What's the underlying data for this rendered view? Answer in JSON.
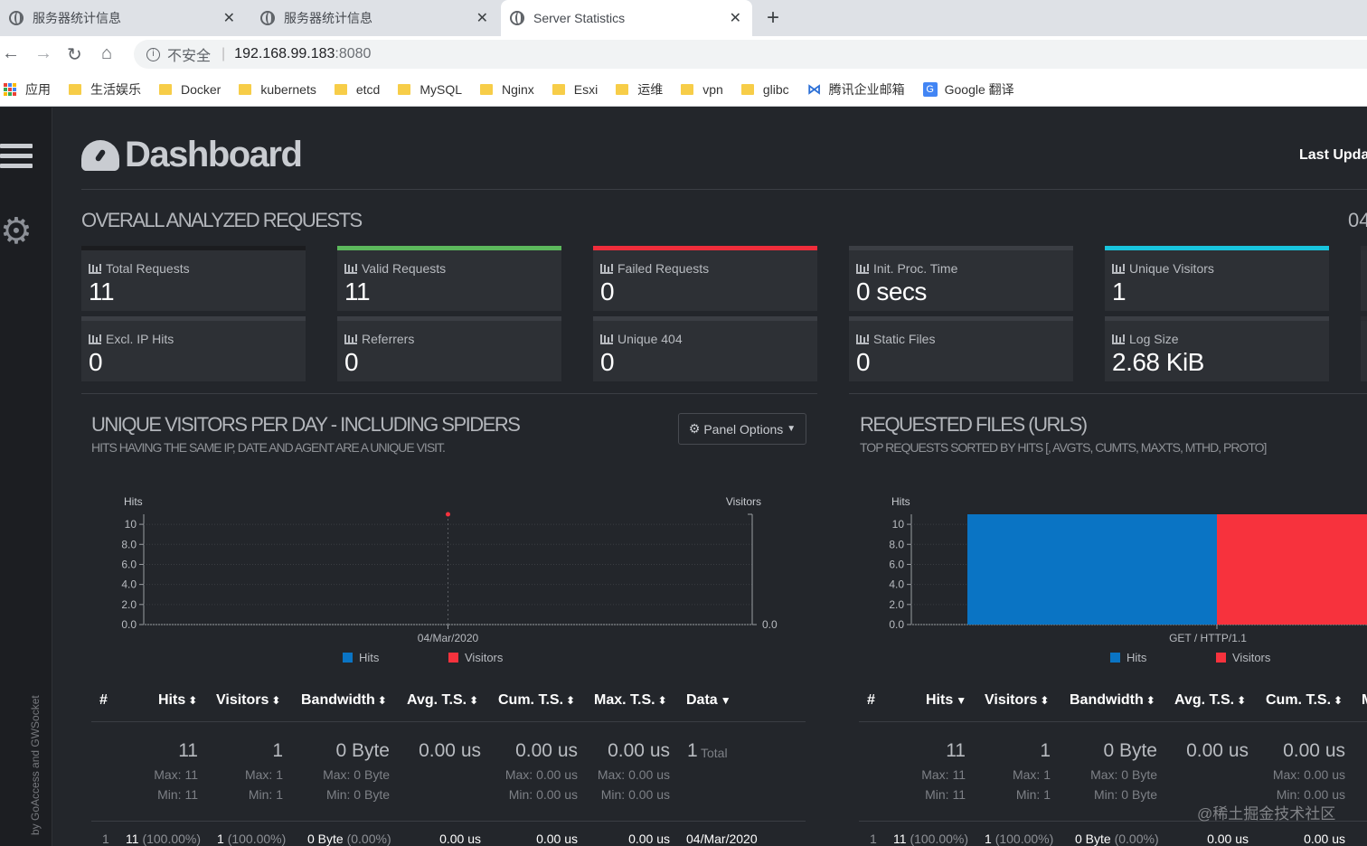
{
  "browser": {
    "tabs": [
      {
        "title": "服务器统计信息",
        "active": false
      },
      {
        "title": "服务器统计信息",
        "active": false
      },
      {
        "title": "Server Statistics",
        "active": true
      }
    ],
    "new_tab_icon": "plus-icon",
    "insecure_label": "不安全",
    "url_host": "192.168.99.183",
    "url_port": ":8080",
    "bookmarks": [
      {
        "label": "应用",
        "icon": "apps-grid-icon"
      },
      {
        "label": "生活娱乐",
        "icon": "folder-icon"
      },
      {
        "label": "Docker",
        "icon": "folder-icon"
      },
      {
        "label": "kubernets",
        "icon": "folder-icon"
      },
      {
        "label": "etcd",
        "icon": "folder-icon"
      },
      {
        "label": "MySQL",
        "icon": "folder-icon"
      },
      {
        "label": "Nginx",
        "icon": "folder-icon"
      },
      {
        "label": "Esxi",
        "icon": "folder-icon"
      },
      {
        "label": "运维",
        "icon": "folder-icon"
      },
      {
        "label": "vpn",
        "icon": "folder-icon"
      },
      {
        "label": "glibc",
        "icon": "folder-icon"
      },
      {
        "label": "腾讯企业邮箱",
        "icon": "tencent-mail-icon"
      },
      {
        "label": "Google 翻译",
        "icon": "google-translate-icon"
      }
    ]
  },
  "dashboard": {
    "title": "Dashboard",
    "last_updated": "Last Upda",
    "byline": "by GoAccess and GWSocket",
    "section_title": "OVERALL ANALYZED REQUESTS",
    "section_date": "04",
    "cards_row1": [
      {
        "label": "Total Requests",
        "value": "11",
        "accent": "#1b1c1f"
      },
      {
        "label": "Valid Requests",
        "value": "11",
        "accent": "#5cb85c"
      },
      {
        "label": "Failed Requests",
        "value": "0",
        "accent": "#ef2d3b"
      },
      {
        "label": "Init. Proc. Time",
        "value": "0 secs",
        "accent": "#3b3e44"
      },
      {
        "label": "Unique Visitors",
        "value": "1",
        "accent": "#18c4dd"
      }
    ],
    "cards_row2": [
      {
        "label": "Excl. IP Hits",
        "value": "0"
      },
      {
        "label": "Referrers",
        "value": "0"
      },
      {
        "label": "Unique 404",
        "value": "0"
      },
      {
        "label": "Static Files",
        "value": "0"
      },
      {
        "label": "Log Size",
        "value": "2.68 KiB"
      }
    ]
  },
  "visitors_panel": {
    "title": "UNIQUE VISITORS PER DAY - INCLUDING SPIDERS",
    "subtitle": "HITS HAVING THE SAME IP, DATE AND AGENT ARE A UNIQUE VISIT.",
    "options_label": "Panel Options",
    "legend": [
      "Hits",
      "Visitors"
    ],
    "columns": [
      "#",
      "Hits",
      "Visitors",
      "Bandwidth",
      "Avg. T.S.",
      "Cum. T.S.",
      "Max. T.S.",
      "Data"
    ],
    "summary": {
      "hits": "11",
      "hits_max": "Max: 11",
      "hits_min": "Min: 11",
      "visitors": "1",
      "visitors_max": "Max: 1",
      "visitors_min": "Min: 1",
      "bandwidth": "0 Byte",
      "bandwidth_max": "Max: 0 Byte",
      "bandwidth_min": "Min: 0 Byte",
      "avg_ts": "0.00 us",
      "cum_ts": "0.00 us",
      "cum_ts_max": "Max: 0.00 us",
      "cum_ts_min": "Min: 0.00 us",
      "max_ts": "0.00 us",
      "max_ts_max": "Max: 0.00 us",
      "max_ts_min": "Min: 0.00 us",
      "data_count": "1",
      "data_total": "Total"
    },
    "row": {
      "num": "1",
      "hits": "11",
      "hits_pct": "(100.00%)",
      "visitors": "1",
      "visitors_pct": "(100.00%)",
      "bandwidth": "0 Byte",
      "bandwidth_pct": "(0.00%)",
      "avg_ts": "0.00 us",
      "cum_ts": "0.00 us",
      "data": "04/Mar/2020"
    }
  },
  "files_panel": {
    "title": "REQUESTED FILES (URLS)",
    "subtitle": "TOP REQUESTS SORTED BY HITS [, AVGTS, CUMTS, MAXTS, MTHD, PROTO]",
    "legend": [
      "Hits",
      "Visitors"
    ],
    "columns": [
      "#",
      "Hits",
      "Visitors",
      "Bandwidth",
      "Avg. T.S.",
      "Cum. T.S.",
      "M"
    ],
    "summary": {
      "hits": "11",
      "hits_max": "Max: 11",
      "hits_min": "Min: 11",
      "visitors": "1",
      "visitors_max": "Max: 1",
      "visitors_min": "Min: 1",
      "bandwidth": "0 Byte",
      "bandwidth_max": "Max: 0 Byte",
      "bandwidth_min": "Min: 0 Byte",
      "avg_ts": "0.00 us",
      "cum_ts": "0.00 us",
      "cum_ts_max": "Max: 0.00 us",
      "cum_ts_min": "Min: 0.00 us"
    },
    "row": {
      "num": "1",
      "hits": "11",
      "hits_pct": "(100.00%)",
      "visitors": "1",
      "visitors_pct": "(100.00%)",
      "bandwidth": "0 Byte",
      "bandwidth_pct": "(0.00%)",
      "avg_ts": "0.00 us",
      "cum_ts": "0.00 us"
    }
  },
  "watermark": "@稀土掘金技术社区",
  "colors": {
    "hits": "#0a74c4",
    "visitors": "#f7323d"
  },
  "chart_data": [
    {
      "type": "line",
      "ylabel": "Hits",
      "y2label": "Visitors",
      "ylim": [
        0,
        11
      ],
      "yticks": [
        "10",
        "8.0",
        "6.0",
        "4.0",
        "2.0",
        "0.0"
      ],
      "y2ticks": [
        "0.0"
      ],
      "categories": [
        "04/Mar/2020"
      ],
      "series": [
        {
          "name": "Hits",
          "values": [
            11
          ]
        },
        {
          "name": "Visitors",
          "values": [
            1
          ]
        }
      ]
    },
    {
      "type": "bar",
      "ylabel": "Hits",
      "ylim": [
        0,
        11
      ],
      "yticks": [
        "10",
        "8.0",
        "6.0",
        "4.0",
        "2.0",
        "0.0"
      ],
      "categories": [
        "GET / HTTP/1.1"
      ],
      "series": [
        {
          "name": "Hits",
          "values": [
            11
          ]
        },
        {
          "name": "Visitors",
          "values": [
            1
          ]
        }
      ]
    }
  ]
}
